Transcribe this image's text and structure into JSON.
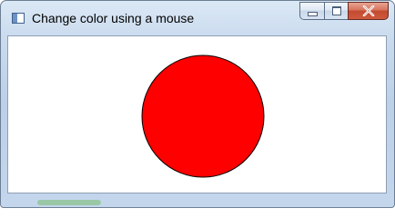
{
  "window": {
    "title": "Change color using a mouse"
  },
  "icons": {
    "app": "app-window-icon",
    "minimize": "minimize-icon",
    "maximize": "maximize-icon",
    "close": "close-icon"
  },
  "circle": {
    "fill_color": "#ff0000",
    "stroke_color": "#000000"
  }
}
